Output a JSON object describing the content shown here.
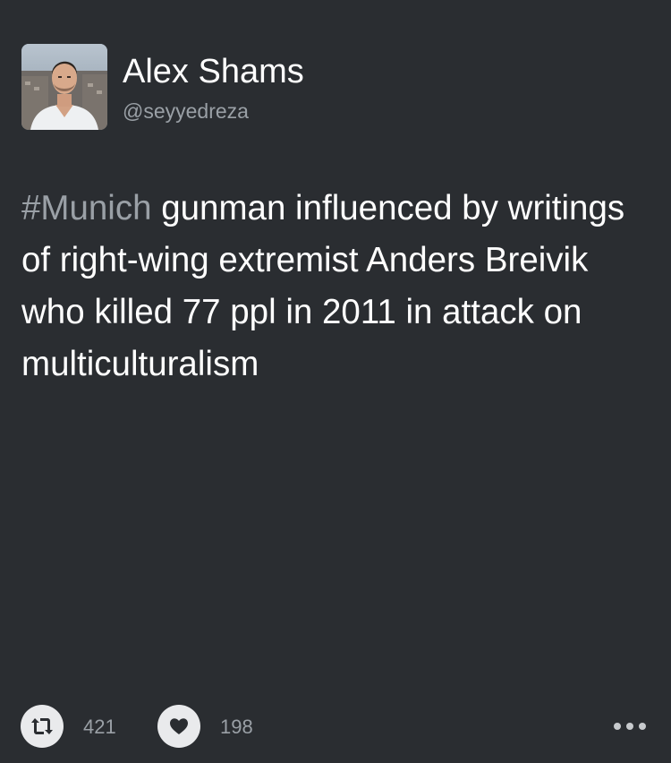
{
  "user": {
    "display_name": "Alex Shams",
    "handle": "@seyyedreza",
    "avatar_icon": "profile-photo"
  },
  "tweet": {
    "hashtag": "#Munich",
    "text": " gunman influenced by writings of right-wing extremist Anders Breivik who killed 77 ppl in 2011 in attack on multiculturalism"
  },
  "actions": {
    "retweet_icon": "retweet-icon",
    "retweet_count": "421",
    "like_icon": "heart-icon",
    "like_count": "198",
    "more_icon": "more-dots-icon"
  },
  "colors": {
    "background": "#2a2d31",
    "text": "#ffffff",
    "muted": "#9aa0a6",
    "button_fill": "#e9eaec"
  }
}
